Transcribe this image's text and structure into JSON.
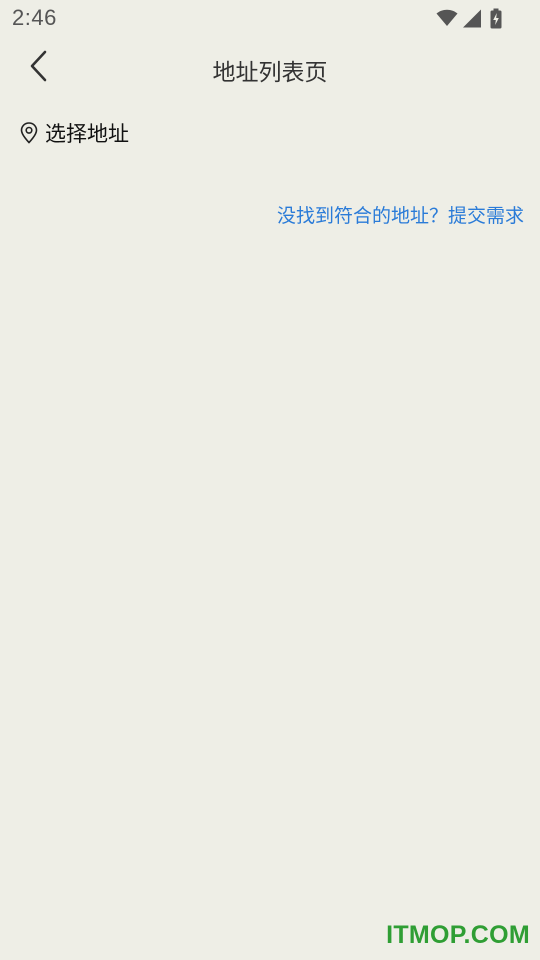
{
  "status_bar": {
    "time": "2:46",
    "icons": [
      "wifi-icon",
      "cellular-signal-icon",
      "battery-charging-icon"
    ]
  },
  "app_bar": {
    "title": "地址列表页",
    "back_icon": "chevron-left-icon"
  },
  "address_selector": {
    "icon": "location-pin-icon",
    "label": "选择地址"
  },
  "request_link": {
    "text": "没找到符合的地址？提交需求",
    "color": "#2a7bd8"
  },
  "watermark": {
    "text": "ITMOP.COM",
    "color": "#2f9e34"
  },
  "colors": {
    "background": "#eeeee6",
    "link": "#2a7bd8"
  }
}
